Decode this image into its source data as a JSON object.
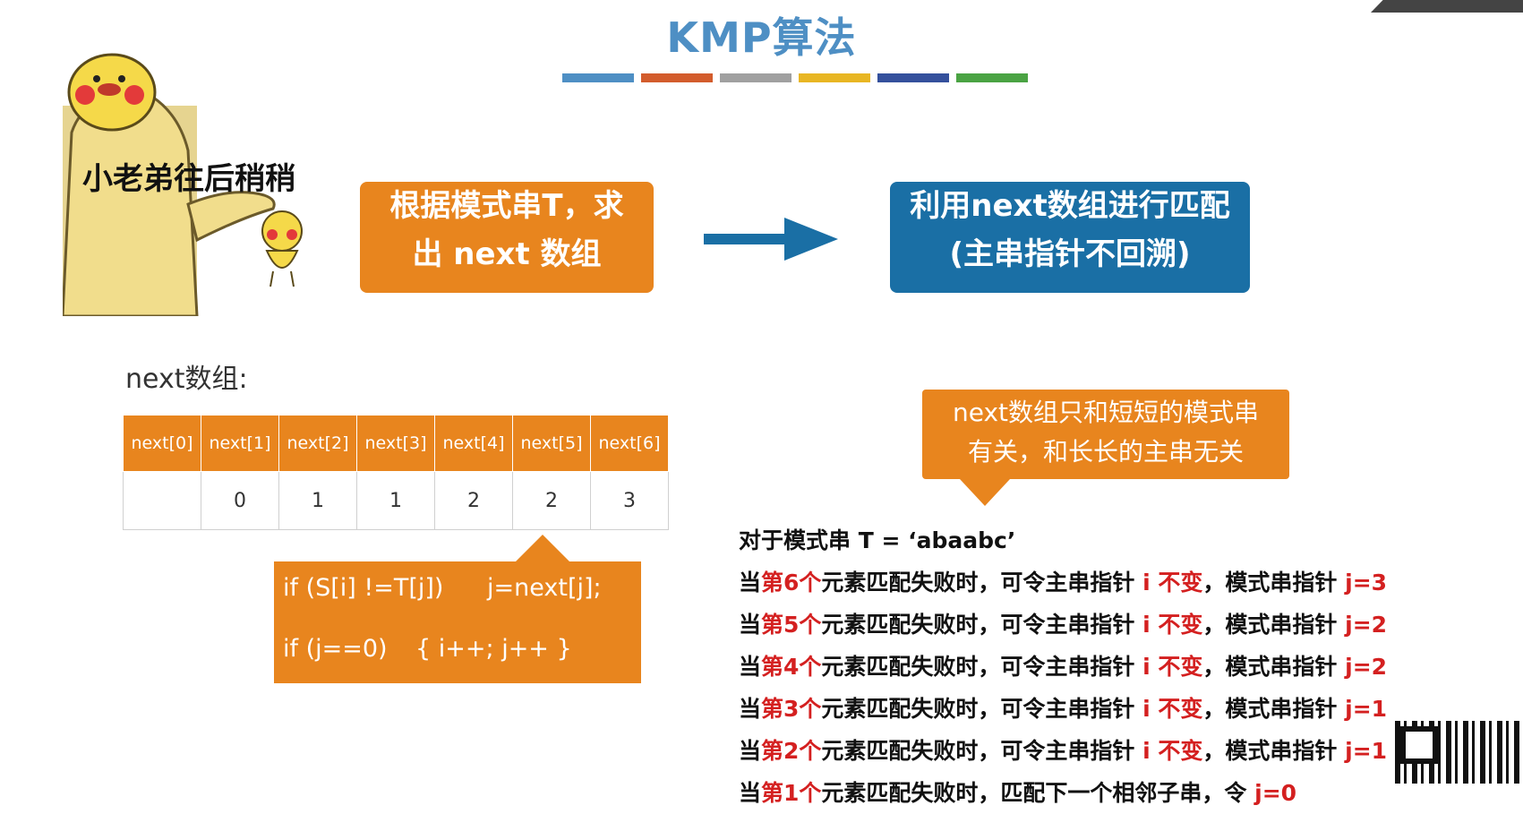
{
  "title": "KMP算法",
  "title_bar_colors": [
    "#4e8fc4",
    "#d35c2c",
    "#a0a0a0",
    "#e8b623",
    "#34509c",
    "#4aa343"
  ],
  "mascot": {
    "caption": "小老弟往后稍稍"
  },
  "flow": {
    "step1_line1": "根据模式串T，求",
    "step1_line2": "出 next 数组",
    "step2_line1": "利用next数组进行匹配",
    "step2_line2": "(主串指针不回溯)"
  },
  "next_label": "next数组:",
  "next_table": {
    "headers": [
      "next[0]",
      "next[1]",
      "next[2]",
      "next[3]",
      "next[4]",
      "next[5]",
      "next[6]"
    ],
    "values": [
      "",
      "0",
      "1",
      "1",
      "2",
      "2",
      "3"
    ]
  },
  "code": {
    "line1a": "if (S[i] !=T[j])",
    "line1b": "j=next[j];",
    "line2a": "if (j==0)",
    "line2b": "{ i++; j++ }"
  },
  "note": {
    "line1": "next数组只和短短的模式串",
    "line2": "有关，和长长的主串无关"
  },
  "rules": {
    "header": "对于模式串 T = ‘abaabc’",
    "items": [
      {
        "prefix": "当",
        "ordinal": "第6个",
        "middle": "元素匹配失败时，可令主串指针 ",
        "i_part": "i 不变",
        "comma": "，模式串指针 ",
        "j_part": "j=3"
      },
      {
        "prefix": "当",
        "ordinal": "第5个",
        "middle": "元素匹配失败时，可令主串指针 ",
        "i_part": "i 不变",
        "comma": "，模式串指针 ",
        "j_part": "j=2"
      },
      {
        "prefix": "当",
        "ordinal": "第4个",
        "middle": "元素匹配失败时，可令主串指针 ",
        "i_part": "i 不变",
        "comma": "，模式串指针 ",
        "j_part": "j=2"
      },
      {
        "prefix": "当",
        "ordinal": "第3个",
        "middle": "元素匹配失败时，可令主串指针 ",
        "i_part": "i 不变",
        "comma": "，模式串指针 ",
        "j_part": "j=1"
      },
      {
        "prefix": "当",
        "ordinal": "第2个",
        "middle": "元素匹配失败时，可令主串指针 ",
        "i_part": "i 不变",
        "comma": "，模式串指针 ",
        "j_part": "j=1"
      },
      {
        "prefix": "当",
        "ordinal": "第1个",
        "middle": "元素匹配失败时，匹配下一个相邻子串，令 ",
        "i_part": "",
        "comma": "",
        "j_part": "j=0"
      }
    ]
  }
}
